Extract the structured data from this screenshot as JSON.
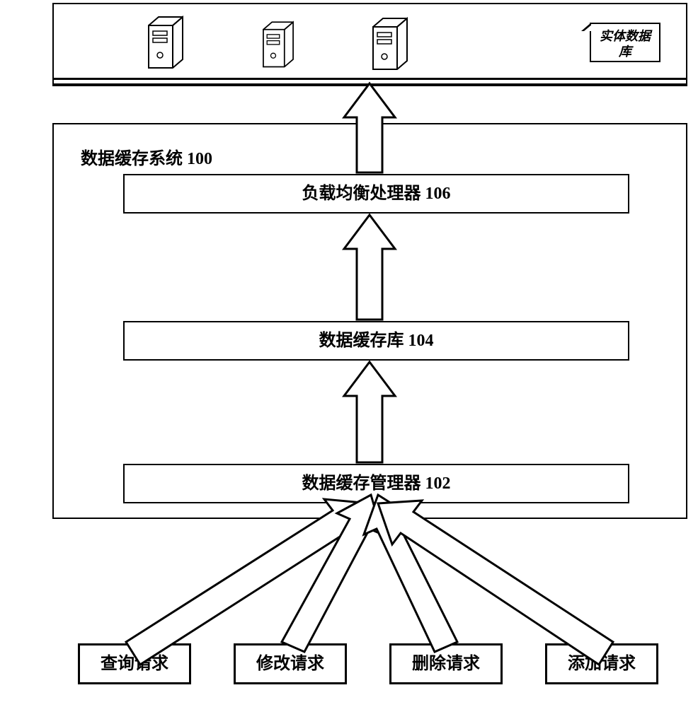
{
  "top": {
    "db_label_line1": "实体数据",
    "db_label_line2": "库"
  },
  "system": {
    "title": "数据缓存系统 100",
    "blocks": {
      "load_balancer": "负载均衡处理器  106",
      "cache_store": "数据缓存库 104",
      "cache_manager": "数据缓存管理器 102"
    }
  },
  "requests": {
    "query": "查询请求",
    "modify": "修改请求",
    "delete": "删除请求",
    "add": "添加请求"
  }
}
